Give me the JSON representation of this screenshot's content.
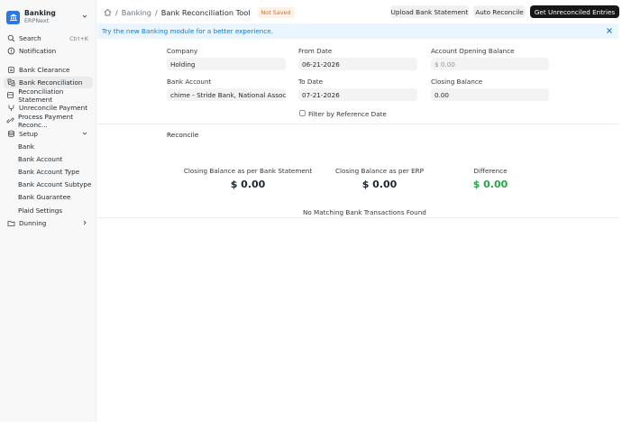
{
  "sidebar": {
    "app_title": "Banking",
    "app_subtitle": "ERPNext",
    "search_label": "Search",
    "search_shortcut": "Ctrl+K",
    "notification_label": "Notification",
    "items": [
      {
        "label": "Bank Clearance",
        "icon": "file-icon"
      },
      {
        "label": "Bank Reconciliation",
        "icon": "reconcile-icon"
      },
      {
        "label": "Reconciliation Statement",
        "icon": "list-icon"
      },
      {
        "label": "Unreconcile Payment",
        "icon": "branch-icon"
      },
      {
        "label": "Process Payment Reconc...",
        "icon": "link-icon"
      }
    ],
    "setup_label": "Setup",
    "setup_items": [
      "Bank",
      "Bank Account",
      "Bank Account Type",
      "Bank Account Subtype",
      "Bank Guarantee",
      "Plaid Settings"
    ],
    "dunning_label": "Dunning"
  },
  "header": {
    "breadcrumb_1": "Banking",
    "breadcrumb_2": "Bank Reconciliation Tool",
    "status_badge": "Not Saved",
    "upload_button": "Upload Bank Statement",
    "auto_button": "Auto Reconcile",
    "get_button": "Get Unreconciled Entries"
  },
  "banner": {
    "text_prefix": "Try the new Banking module ",
    "text_link": "for a better experience."
  },
  "form": {
    "company_label": "Company",
    "company_value": "Holding",
    "from_date_label": "From Date",
    "from_date_value": "06-21-2026",
    "opening_label": "Account Opening Balance",
    "opening_placeholder": "$ 0.00",
    "bank_account_label": "Bank Account",
    "bank_account_value": "chime - Stride Bank, National Associa",
    "to_date_label": "To Date",
    "to_date_value": "07-21-2026",
    "closing_label": "Closing Balance",
    "closing_value": "0.00",
    "filter_label": "Filter by Reference Date"
  },
  "reconcile": {
    "title": "Reconcile",
    "stmt_label": "Closing Balance as per Bank Statement",
    "stmt_value": "$ 0.00",
    "erp_label": "Closing Balance as per ERP",
    "erp_value": "$ 0.00",
    "diff_label": "Difference",
    "diff_value": "$ 0.00",
    "diff_color": "#28a745",
    "empty_text": "No Matching Bank Transactions Found"
  }
}
